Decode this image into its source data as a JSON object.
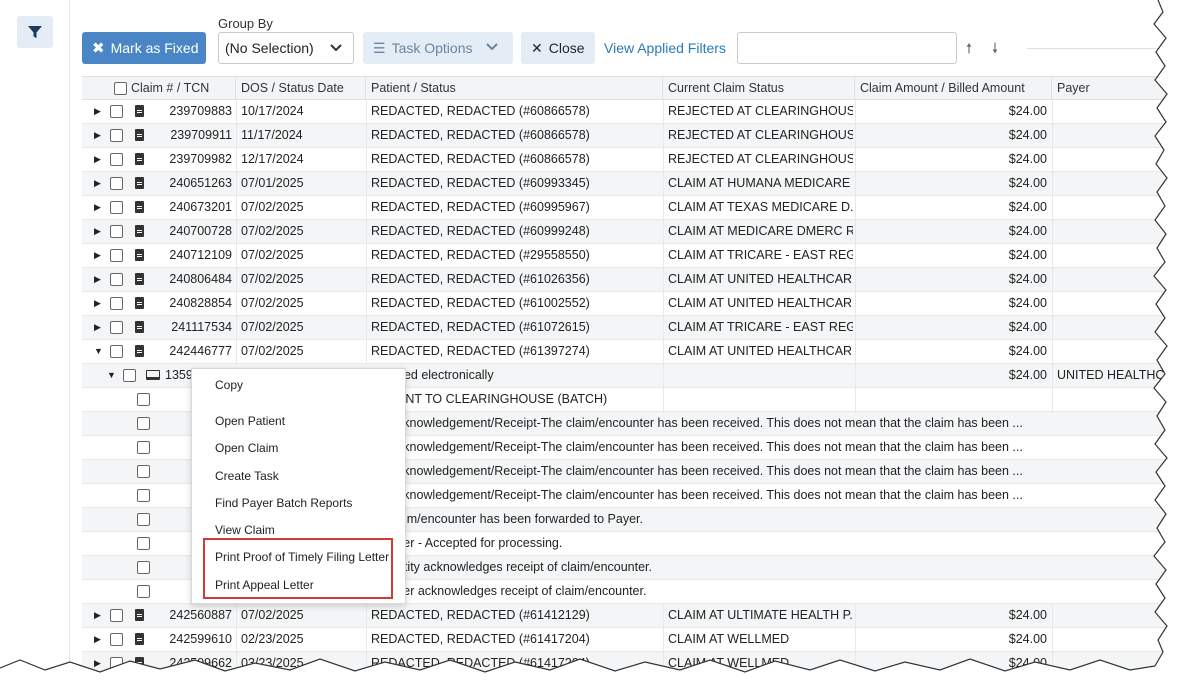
{
  "toolbar": {
    "mark_fixed": "Mark as Fixed",
    "group_by_label": "Group By",
    "group_by_value": "(No Selection)",
    "task_options": "Task Options",
    "close": "Close",
    "view_filters": "View Applied Filters",
    "search_value": ""
  },
  "grid": {
    "columns": [
      "Claim # / TCN",
      "DOS / Status Date",
      "Patient / Status",
      "Current Claim Status",
      "Claim Amount / Billed Amount",
      "Payer"
    ],
    "rows": [
      {
        "claim": "239709883",
        "date": "10/17/2024",
        "patient": "REDACTED, REDACTED (#60866578)",
        "status": "REJECTED AT CLEARINGHOUSE",
        "amount": "$24.00"
      },
      {
        "claim": "239709911",
        "date": "11/17/2024",
        "patient": "REDACTED, REDACTED (#60866578)",
        "status": "REJECTED AT CLEARINGHOUSE",
        "amount": "$24.00"
      },
      {
        "claim": "239709982",
        "date": "12/17/2024",
        "patient": "REDACTED, REDACTED (#60866578)",
        "status": "REJECTED AT CLEARINGHOUSE",
        "amount": "$24.00"
      },
      {
        "claim": "240651263",
        "date": "07/01/2025",
        "patient": "REDACTED, REDACTED (#60993345)",
        "status": "CLAIM AT HUMANA MEDICARE",
        "amount": "$24.00"
      },
      {
        "claim": "240673201",
        "date": "07/02/2025",
        "patient": "REDACTED, REDACTED (#60995967)",
        "status": "CLAIM AT TEXAS MEDICARE D...",
        "amount": "$24.00"
      },
      {
        "claim": "240700728",
        "date": "07/02/2025",
        "patient": "REDACTED, REDACTED (#60999248)",
        "status": "CLAIM AT MEDICARE DMERC R...",
        "amount": "$24.00"
      },
      {
        "claim": "240712109",
        "date": "07/02/2025",
        "patient": "REDACTED, REDACTED (#29558550)",
        "status": "CLAIM AT TRICARE - EAST REG...",
        "amount": "$24.00"
      },
      {
        "claim": "240806484",
        "date": "07/02/2025",
        "patient": "REDACTED, REDACTED (#61026356)",
        "status": "CLAIM AT UNITED HEALTHCARE",
        "amount": "$24.00"
      },
      {
        "claim": "240828854",
        "date": "07/02/2025",
        "patient": "REDACTED, REDACTED (#61002552)",
        "status": "CLAIM AT UNITED HEALTHCAR...",
        "amount": "$24.00"
      },
      {
        "claim": "241117534",
        "date": "07/02/2025",
        "patient": "REDACTED, REDACTED (#61072615)",
        "status": "CLAIM AT TRICARE - EAST REG...",
        "amount": "$24.00"
      },
      {
        "claim": "242446777",
        "date": "07/02/2025",
        "patient": "REDACTED, REDACTED (#61397274)",
        "status": "CLAIM AT UNITED HEALTHCAR...",
        "amount": "$24.00"
      }
    ],
    "sub_row": {
      "claim": "1359",
      "patient": "tted electronically",
      "amount": "$24.00",
      "payer": "UNITED HEALTHCA"
    },
    "history": [
      "ENT TO CLEARINGHOUSE (BATCH)",
      "cknowledgement/Receipt-The claim/encounter has been received. This does not mean that the claim has been ...",
      "cknowledgement/Receipt-The claim/encounter has been received. This does not mean that the claim has been ...",
      "cknowledgement/Receipt-The claim/encounter has been received. This does not mean that the claim has been ...",
      "cknowledgement/Receipt-The claim/encounter has been received. This does not mean that the claim has been ...",
      "aim/encounter has been forwarded to Payer.",
      "yer - Accepted for processing.",
      "ntity acknowledges receipt of claim/encounter.",
      "yer acknowledges receipt of claim/encounter."
    ],
    "rows_after": [
      {
        "claim": "242560887",
        "date": "07/02/2025",
        "patient": "REDACTED, REDACTED (#61412129)",
        "status": "CLAIM AT ULTIMATE HEALTH P...",
        "amount": "$24.00"
      },
      {
        "claim": "242599610",
        "date": "02/23/2025",
        "patient": "REDACTED, REDACTED (#61417204)",
        "status": "CLAIM AT WELLMED",
        "amount": "$24.00"
      },
      {
        "claim": "242599662",
        "date": "03/23/2025",
        "patient": "REDACTED, REDACTED (#61417204)",
        "status": "CLAIM AT WELLMED",
        "amount": "$24.00"
      }
    ]
  },
  "context_menu": {
    "items": [
      "Copy",
      "Open Patient",
      "Open Claim",
      "Create Task",
      "Find Payer Batch Reports",
      "View Claim",
      "Print Proof of Timely Filing Letter",
      "Print Appeal Letter"
    ]
  },
  "colors": {
    "primary": "#4a86c5",
    "secondary_bg": "#e4edf6",
    "link": "#2a7ab8",
    "highlight": "#d23a3a"
  }
}
